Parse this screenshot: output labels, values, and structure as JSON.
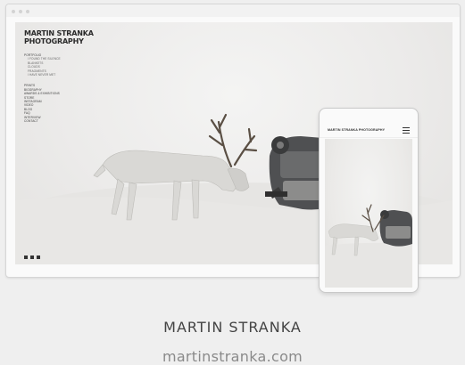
{
  "site": {
    "title": "MARTIN STRANKA PHOTOGRAPHY",
    "nav_items": [
      {
        "label": "PORTFOLIO",
        "sub": false
      },
      {
        "label": "I FOUND THE SILENCE",
        "sub": true
      },
      {
        "label": "BLANKETS",
        "sub": true
      },
      {
        "label": "CLOUDS",
        "sub": true
      },
      {
        "label": "FRAGMENTS",
        "sub": true
      },
      {
        "label": "I HAVE NEVER MET",
        "sub": true
      },
      {
        "label": "PRINTS",
        "sub": false,
        "gap": true
      },
      {
        "label": "BIOGRAPHY",
        "sub": false
      },
      {
        "label": "AWARDS & EXHIBITIONS",
        "sub": false
      },
      {
        "label": "STORE",
        "sub": false
      },
      {
        "label": "INSTAGRAM",
        "sub": false
      },
      {
        "label": "VIDEO",
        "sub": false
      },
      {
        "label": "BLOG",
        "sub": false
      },
      {
        "label": "FAQ",
        "sub": false
      },
      {
        "label": "INTERVIEW",
        "sub": false
      },
      {
        "label": "CONTACT",
        "sub": false
      }
    ],
    "social_icons": [
      "facebook-icon",
      "twitter-icon",
      "instagram-icon"
    ]
  },
  "phone": {
    "title": "MARTIN STRANKA PHOTOGRAPHY",
    "menu_icon": "hamburger-menu-icon"
  },
  "caption": {
    "name": "MARTIN STRANKA",
    "url": "martinstranka.com"
  }
}
